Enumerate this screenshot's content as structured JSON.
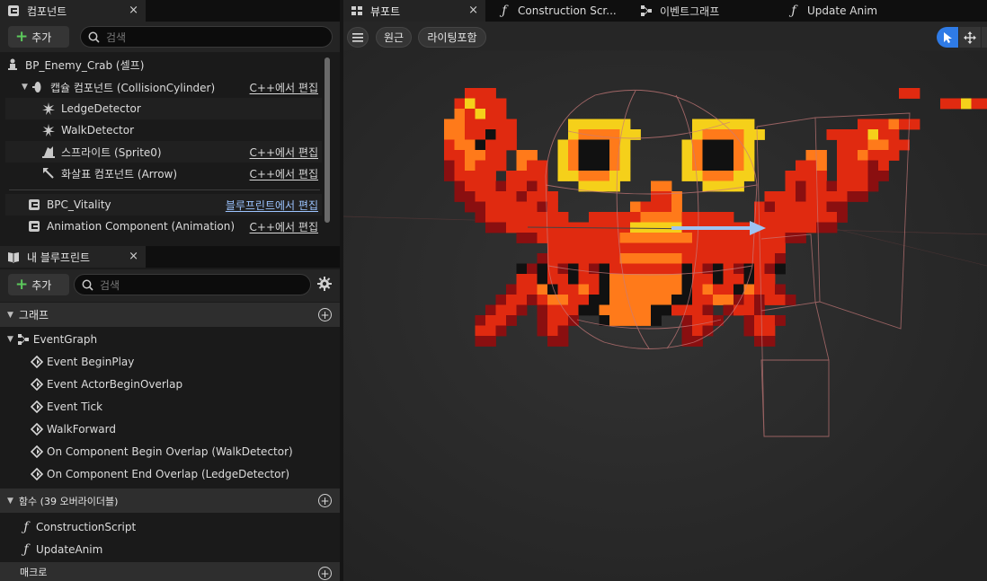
{
  "components_panel": {
    "tab_title": "컴포넌트",
    "close_glyph": "×",
    "add_label": "추가",
    "search_placeholder": "검색",
    "items": [
      {
        "label": "BP_Enemy_Crab (셀프)",
        "edit": "",
        "icon": "actor-icon"
      },
      {
        "label": "캡슐 컴포넌트 (CollisionCylinder)",
        "edit": "C++에서 편집",
        "icon": "capsule-icon"
      },
      {
        "label": "LedgeDetector",
        "edit": "",
        "icon": "scene-component-icon"
      },
      {
        "label": "WalkDetector",
        "edit": "",
        "icon": "scene-component-icon"
      },
      {
        "label": "스프라이트 (Sprite0)",
        "edit": "C++에서 편집",
        "icon": "sprite-icon"
      },
      {
        "label": "화살표 컴포넌트 (Arrow)",
        "edit": "C++에서 편집",
        "icon": "arrow-icon"
      },
      {
        "label": "BPC_Vitality",
        "edit": "블루프린트에서 편집",
        "icon": "blueprint-component-icon"
      },
      {
        "label": "Animation Component (Animation)",
        "edit": "C++에서 편집",
        "icon": "blueprint-component-icon"
      }
    ]
  },
  "my_blueprint_panel": {
    "tab_title": "내 블루프린트",
    "close_glyph": "×",
    "add_label": "추가",
    "search_placeholder": "검색",
    "sections": {
      "graphs": "그래프",
      "functions": "함수 (39 오버라이더블)",
      "macros": "매크로"
    },
    "event_graph": "EventGraph",
    "events": [
      "Event BeginPlay",
      "Event ActorBeginOverlap",
      "Event Tick",
      "WalkForward",
      "On Component Begin Overlap (WalkDetector)",
      "On Component End Overlap (LedgeDetector)"
    ],
    "functions": [
      "ConstructionScript",
      "UpdateAnim"
    ]
  },
  "viewport": {
    "tabs": [
      {
        "label": "뷰포트",
        "icon": "viewport-icon",
        "close": "×"
      },
      {
        "label": "Construction Scr...",
        "icon": "function-icon"
      },
      {
        "label": "이벤트그래프",
        "icon": "graph-icon"
      },
      {
        "label": "Update Anim",
        "icon": "function-icon"
      }
    ],
    "toolbar": {
      "menu_icon": "hamburger-icon",
      "perspective": "원근",
      "lighting": "라이팅포함",
      "select_tool": "select-arrow-icon",
      "move_tool": "move-icon"
    }
  },
  "colors": {
    "crab_red": "#e02a10",
    "crab_dark": "#8a0f10",
    "crab_orange": "#ff7a1a",
    "crab_yellow": "#f5d01a",
    "crab_black": "#111111",
    "accent_blue": "#2f7be6",
    "bp_link": "#9cc4ff"
  }
}
